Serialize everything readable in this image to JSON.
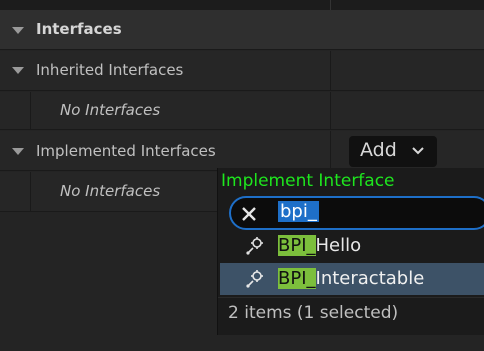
{
  "details": {
    "section_title": "Interfaces",
    "inherited": {
      "label": "Inherited Interfaces",
      "empty": "No Interfaces"
    },
    "implemented": {
      "label": "Implemented Interfaces",
      "empty": "No Interfaces",
      "add_button": "Add"
    }
  },
  "popup": {
    "title": "Implement Interface",
    "search_value": "bpi_",
    "items": [
      {
        "highlight": "BPI_",
        "rest": "Hello",
        "icon": "interface-icon",
        "selected": false
      },
      {
        "highlight": "BPI_",
        "rest": "Interactable",
        "icon": "interface-icon",
        "selected": true
      }
    ],
    "status": "2 items (1 selected)"
  },
  "colors": {
    "title_green": "#1ee61e",
    "highlight_green": "#7cbf3c",
    "selection_bg": "#3d5267",
    "search_border": "#1e6fc8"
  }
}
